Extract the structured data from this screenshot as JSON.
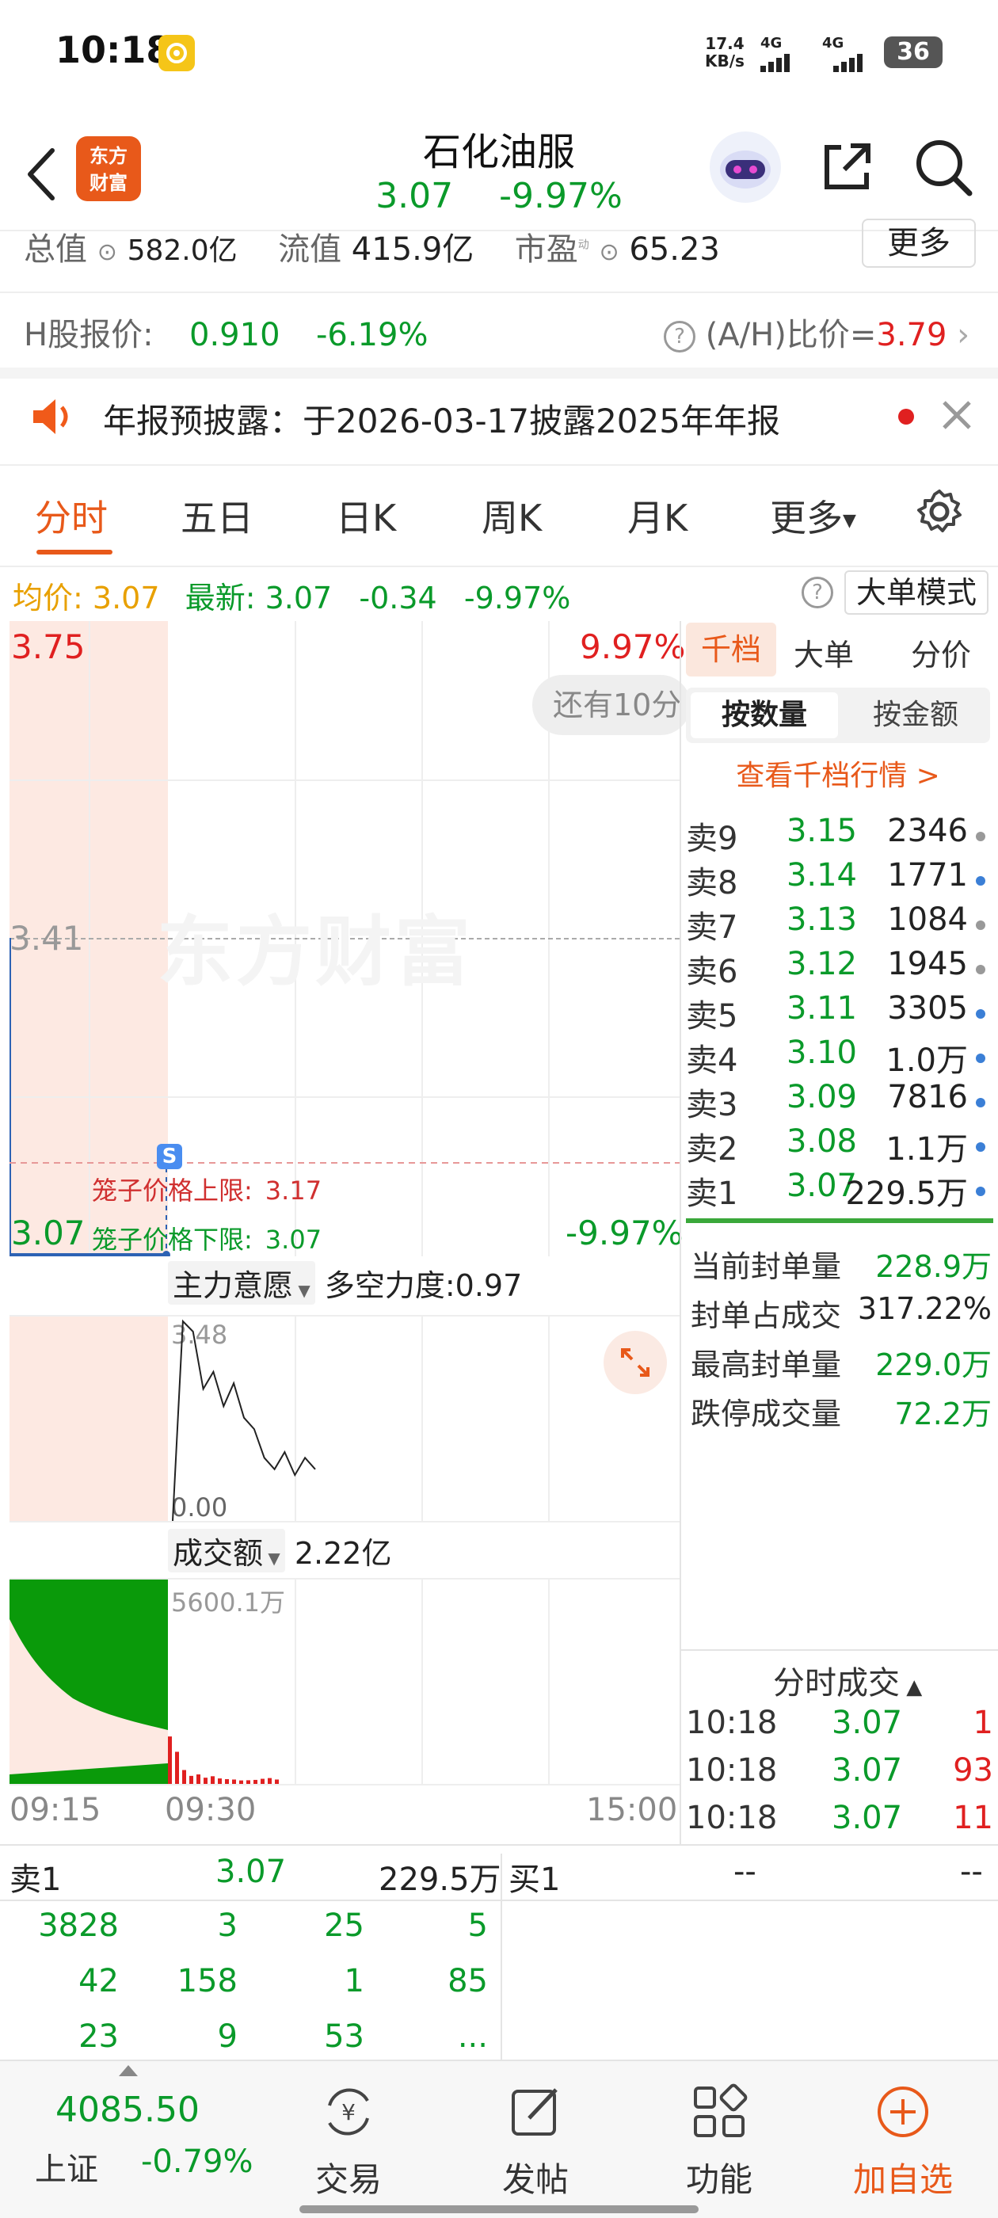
{
  "status_bar": {
    "time": "10:18",
    "net_speed_value": "17.4",
    "net_speed_unit": "KB/s",
    "signal1": "4G",
    "signal2": "4G",
    "battery": "36"
  },
  "header": {
    "logo_line1": "东方",
    "logo_line2": "财富",
    "stock_name": "石化油服",
    "price": "3.07",
    "change_pct": "-9.97%"
  },
  "summary": {
    "total_value_label": "总值",
    "total_value": "582.0亿",
    "float_value_label": "流值",
    "float_value": "415.9亿",
    "pe_label": "市盈",
    "pe_sup": "动",
    "pe_value": "65.23",
    "more_button": "更多"
  },
  "h_share": {
    "label": "H股报价:",
    "price": "0.910",
    "change": "-6.19%",
    "ah_label": "(A/H)比价=",
    "ah_value": "3.79"
  },
  "notice": {
    "text": "年报预披露：于2026-03-17披露2025年年报"
  },
  "tabs": [
    "分时",
    "五日",
    "日K",
    "周K",
    "月K",
    "更多"
  ],
  "quote_line": {
    "avg_label": "均价:",
    "avg_value": "3.07",
    "latest_label": "最新:",
    "latest_value": "3.07",
    "change": "-0.34",
    "change_pct": "-9.97%",
    "big_order_mode": "大单模式"
  },
  "chart": {
    "y_top": "3.75",
    "y_top_pct": "9.97%",
    "y_mid": "3.41",
    "y_bottom": "3.07",
    "y_bottom_pct": "-9.97%",
    "bubble_text": "还有10分",
    "watermark": "东方财富",
    "s_badge": "S",
    "cage_upper_label": "笼子价格上限:",
    "cage_upper_value": "3.17",
    "cage_lower_label": "笼子价格下限:",
    "cage_lower_value": "3.07",
    "sub1_selector": "主力意愿",
    "sub1_label": "多空力度:",
    "sub1_value": "0.97",
    "sub1_max": "3.48",
    "sub1_min": "0.00",
    "sub2_selector": "成交额",
    "sub2_value": "2.22亿",
    "sub2_max": "5600.1万",
    "time_start": "09:15",
    "time_open": "09:30",
    "time_end": "15:00"
  },
  "order_panel": {
    "tabs": [
      "千档",
      "大单",
      "分价"
    ],
    "subtabs": [
      "按数量",
      "按金额"
    ],
    "view_link": "查看千档行情 >",
    "asks": [
      {
        "label": "卖9",
        "price": "3.15",
        "vol": "2346",
        "dot": "#999999"
      },
      {
        "label": "卖8",
        "price": "3.14",
        "vol": "1771",
        "dot": "#3b7fd6"
      },
      {
        "label": "卖7",
        "price": "3.13",
        "vol": "1084",
        "dot": "#999999"
      },
      {
        "label": "卖6",
        "price": "3.12",
        "vol": "1945",
        "dot": "#999999"
      },
      {
        "label": "卖5",
        "price": "3.11",
        "vol": "3305",
        "dot": "#3b7fd6"
      },
      {
        "label": "卖4",
        "price": "3.10",
        "vol": "1.0万",
        "dot": "#3b7fd6"
      },
      {
        "label": "卖3",
        "price": "3.09",
        "vol": "7816",
        "dot": "#3b7fd6"
      },
      {
        "label": "卖2",
        "price": "3.08",
        "vol": "1.1万",
        "dot": "#3b7fd6"
      },
      {
        "label": "卖1",
        "price": "3.07",
        "vol": "229.5万",
        "dot": "#3b7fd6"
      }
    ],
    "stats": [
      {
        "label": "当前封单量",
        "value": "228.9万",
        "color": "#0a9a2a"
      },
      {
        "label": "封单占成交",
        "value": "317.22%",
        "color": "#222222"
      },
      {
        "label": "最高封单量",
        "value": "229.0万",
        "color": "#0a9a2a"
      },
      {
        "label": "跌停成交量",
        "value": "72.2万",
        "color": "#0a9a2a"
      }
    ],
    "trades_title": "分时成交",
    "trades": [
      {
        "time": "10:18",
        "price": "3.07",
        "vol": "1"
      },
      {
        "time": "10:18",
        "price": "3.07",
        "vol": "93"
      },
      {
        "time": "10:18",
        "price": "3.07",
        "vol": "11"
      }
    ]
  },
  "level1": {
    "sell_label": "卖1",
    "sell_price": "3.07",
    "sell_vol": "229.5万",
    "buy_label": "买1",
    "buy_price": "--",
    "buy_vol": "--",
    "queue": [
      [
        "3828",
        "3",
        "25",
        "5"
      ],
      [
        "42",
        "158",
        "1",
        "85"
      ],
      [
        "23",
        "9",
        "53",
        "..."
      ]
    ]
  },
  "bottom_nav": {
    "index_value": "4085.50",
    "index_name": "上证",
    "index_change": "-0.79%",
    "items": [
      "交易",
      "发帖",
      "功能",
      "加自选"
    ]
  },
  "chart_data": [
    {
      "type": "line",
      "title": "",
      "x": [
        "09:15",
        "09:30",
        "15:00"
      ],
      "series": [
        {
          "values": [
            3.07,
            3.07
          ]
        }
      ],
      "ylim": [
        3.07,
        3.75
      ]
    },
    {
      "type": "line",
      "title": "多空力度",
      "series": [
        {
          "values": [
            0.0,
            3.48,
            3.3,
            2.3,
            2.6,
            2.0,
            2.4,
            1.8,
            1.6,
            1.1,
            0.9,
            1.2,
            0.8,
            1.1,
            0.9
          ]
        }
      ],
      "ylim": [
        0.0,
        3.48
      ]
    },
    {
      "type": "bar",
      "title": "成交额",
      "ylim": [
        0,
        5600.1
      ],
      "values_after_open": [
        1300,
        880,
        380,
        220,
        260,
        170,
        210,
        150,
        130,
        120,
        95,
        100,
        110,
        140,
        160,
        120
      ]
    }
  ]
}
